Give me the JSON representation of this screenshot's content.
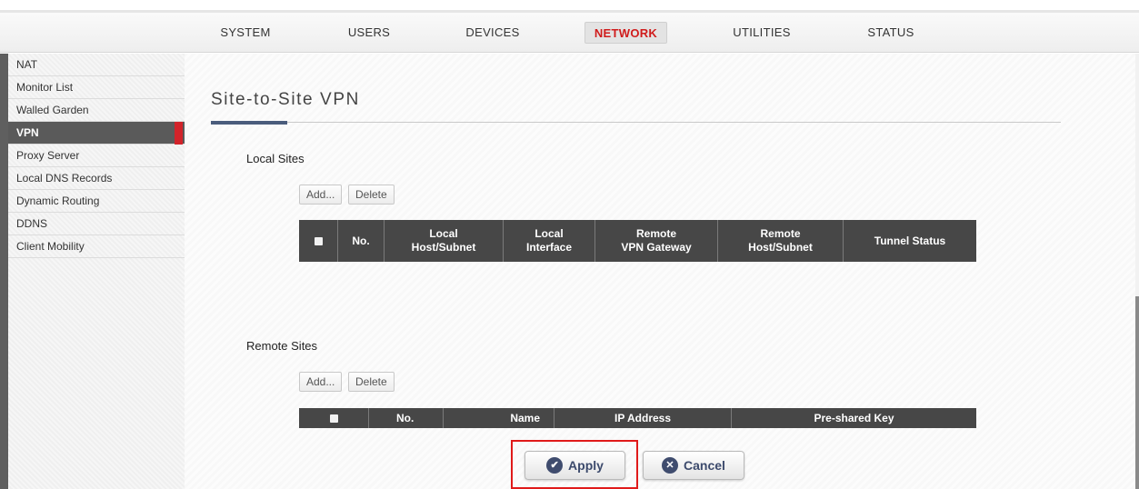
{
  "nav": {
    "tabs": [
      {
        "label": "SYSTEM"
      },
      {
        "label": "USERS"
      },
      {
        "label": "DEVICES"
      },
      {
        "label": "NETWORK"
      },
      {
        "label": "UTILITIES"
      },
      {
        "label": "STATUS"
      }
    ],
    "active_tab": "NETWORK"
  },
  "sidebar": {
    "items": [
      {
        "label": "NAT"
      },
      {
        "label": "Monitor List"
      },
      {
        "label": "Walled Garden"
      },
      {
        "label": "VPN"
      },
      {
        "label": "Proxy Server"
      },
      {
        "label": "Local DNS Records"
      },
      {
        "label": "Dynamic Routing"
      },
      {
        "label": "DDNS"
      },
      {
        "label": "Client Mobility"
      }
    ],
    "active_item": "VPN"
  },
  "page": {
    "title": "Site-to-Site VPN"
  },
  "local_sites": {
    "label": "Local Sites",
    "add_label": "Add...",
    "delete_label": "Delete",
    "columns": [
      "No.",
      "Local\nHost/Subnet",
      "Local\nInterface",
      "Remote\nVPN Gateway",
      "Remote\nHost/Subnet",
      "Tunnel Status"
    ],
    "rows": []
  },
  "remote_sites": {
    "label": "Remote Sites",
    "add_label": "Add...",
    "delete_label": "Delete",
    "columns": [
      "No.",
      "Name",
      "IP Address",
      "Pre-shared Key"
    ],
    "rows": []
  },
  "actions": {
    "apply_label": "Apply",
    "cancel_label": "Cancel"
  },
  "colors": {
    "accent_red": "#d01c1c",
    "table_header": "#474747",
    "button_text": "#3c4a6c"
  }
}
